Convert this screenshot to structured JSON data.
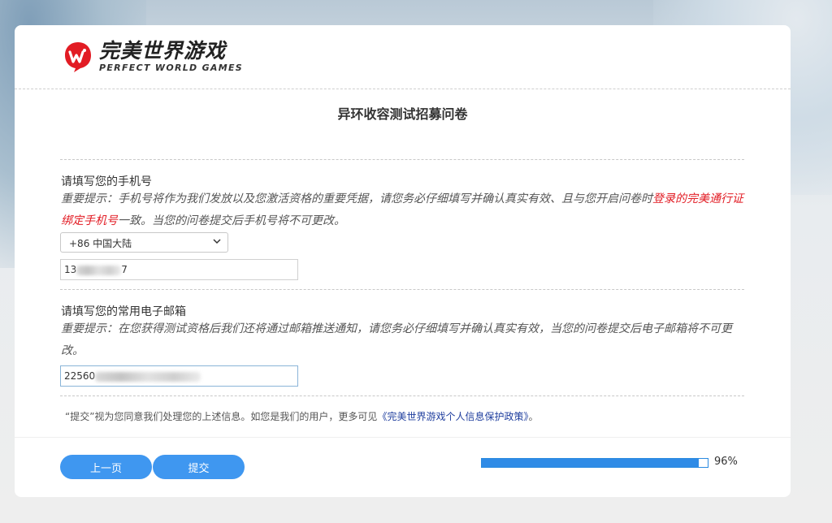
{
  "brand": {
    "name_cn": "完美世界游戏",
    "name_en": "PERFECT WORLD GAMES",
    "color": "#e21c24"
  },
  "survey": {
    "title": "异环收容测试招募问卷"
  },
  "questions": [
    {
      "title": "请填写您的手机号",
      "note_before": "重要提示：手机号将作为我们发放以及您激活资格的重要凭据，请您务必仔细填写并确认真实有效、且与您开启问卷时",
      "note_highlight": "登录的完美通行证绑定手机号",
      "note_after": "一致。当您的问卷提交后手机号将不可更改。",
      "region_selected": "+86 中国大陆",
      "value_visible": "13",
      "value_tail": "7"
    },
    {
      "title": "请填写您的常用电子邮箱",
      "note": "重要提示：在您获得测试资格后我们还将通过邮箱推送通知，请您务必仔细填写并确认真实有效，当您的问卷提交后电子邮箱将不可更改。",
      "value_visible": "22560"
    }
  ],
  "policy": {
    "prefix": "“提交”视为您同意我们处理您的上述信息。如您是我们的用户，更多可见",
    "link": "《完美世界游戏个人信息保护政策》",
    "suffix": "。"
  },
  "buttons": {
    "prev": "上一页",
    "submit": "提交"
  },
  "progress": {
    "value": 0.96,
    "label": "96%",
    "color": "#2f8be6"
  }
}
